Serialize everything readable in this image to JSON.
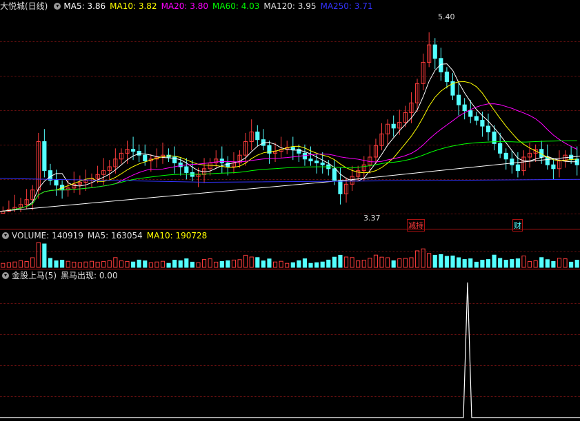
{
  "main_header": {
    "title": "大悦城(日线)",
    "ma5_label": "MA5: 3.86",
    "ma10_label": "MA10: 3.82",
    "ma20_label": "MA20: 3.80",
    "ma60_label": "MA60: 4.03",
    "ma120_label": "MA120: 3.95",
    "ma250_label": "MA250: 3.71"
  },
  "vol_header": {
    "label": "VOLUME: 140919",
    "ma5_label": "MA5: 163054",
    "ma10_label": "MA10: 190728"
  },
  "ind_header": {
    "label": "金股上马(5)",
    "value_label": "黑马出现: 0.00"
  },
  "annotations": {
    "high": "5.40",
    "low": "3.37",
    "tag1": "减持",
    "tag2": "财"
  },
  "colors": {
    "up": "#ff3c3c",
    "down": "#54ffff",
    "ma5": "#ffffff",
    "ma10": "#ffff00",
    "ma20": "#ff00ff",
    "ma60": "#00ff00",
    "ma120": "#ffffff",
    "ma250": "#3333ff",
    "grid": "#6a1010"
  },
  "chart_data": {
    "type": "candlestick",
    "price_range": [
      3.37,
      5.4
    ],
    "closes": [
      3.38,
      3.4,
      3.42,
      3.45,
      3.5,
      3.6,
      4.1,
      3.8,
      3.7,
      3.65,
      3.6,
      3.62,
      3.66,
      3.68,
      3.7,
      3.72,
      3.76,
      3.8,
      3.84,
      3.92,
      3.98,
      4.02,
      4.0,
      3.96,
      3.9,
      3.92,
      3.94,
      3.96,
      3.94,
      3.88,
      3.84,
      3.78,
      3.74,
      3.76,
      3.82,
      3.88,
      3.92,
      3.88,
      3.84,
      3.88,
      3.96,
      4.1,
      4.2,
      4.12,
      4.06,
      3.98,
      4.0,
      4.02,
      4.04,
      4.02,
      3.98,
      3.92,
      3.9,
      3.88,
      3.86,
      3.82,
      3.7,
      3.56,
      3.66,
      3.74,
      3.8,
      3.86,
      3.94,
      4.06,
      4.18,
      4.28,
      4.24,
      4.3,
      4.4,
      4.5,
      4.7,
      4.92,
      5.1,
      4.96,
      4.82,
      4.72,
      4.58,
      4.48,
      4.42,
      4.36,
      4.32,
      4.26,
      4.2,
      4.08,
      3.98,
      3.92,
      3.86,
      3.8,
      3.94,
      3.98,
      4.02,
      3.94,
      3.86,
      3.82,
      3.9,
      3.96,
      3.92,
      3.86
    ]
  }
}
